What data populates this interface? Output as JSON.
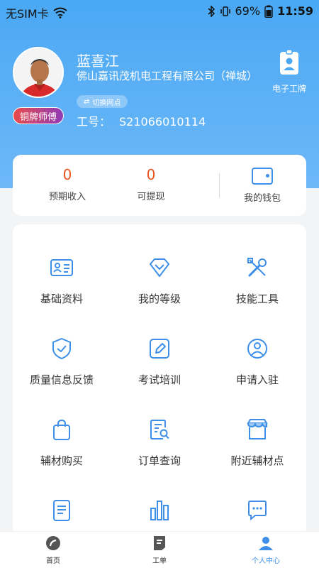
{
  "status_bar": {
    "carrier": "无SIM卡",
    "battery": "69%",
    "time": "11:59"
  },
  "profile": {
    "name": "蓝喜江",
    "company": "佛山嘉讯茂机电工程有限公司（禅城）",
    "switch_label": "切换网点",
    "job_no_label": "工号：",
    "job_no": "S21066010114",
    "rank": "铜牌师傅",
    "badge_label": "电子工牌"
  },
  "wallet": {
    "expected_income_value": "0",
    "expected_income_label": "预期收入",
    "withdrawable_value": "0",
    "withdrawable_label": "可提现",
    "wallet_label": "我的钱包"
  },
  "menu": [
    {
      "label": "基础资料",
      "icon": "id-card-icon"
    },
    {
      "label": "我的等级",
      "icon": "diamond-icon"
    },
    {
      "label": "技能工具",
      "icon": "tools-icon"
    },
    {
      "label": "质量信息反馈",
      "icon": "shield-check-icon"
    },
    {
      "label": "考试培训",
      "icon": "edit-icon"
    },
    {
      "label": "申请入驻",
      "icon": "user-circle-icon"
    },
    {
      "label": "辅材购买",
      "icon": "shopping-bag-icon"
    },
    {
      "label": "订单查询",
      "icon": "document-search-icon"
    },
    {
      "label": "附近辅材点",
      "icon": "store-icon"
    },
    {
      "label": "",
      "icon": "notes-icon"
    },
    {
      "label": "",
      "icon": "bar-chart-icon"
    },
    {
      "label": "",
      "icon": "chat-icon"
    }
  ],
  "tabs": [
    {
      "label": "首页",
      "icon": "home-icon"
    },
    {
      "label": "工单",
      "icon": "order-icon"
    },
    {
      "label": "个人中心",
      "icon": "person-icon"
    }
  ],
  "colors": {
    "primary": "#3d8fe8",
    "accent": "#e8541f",
    "hero": "#4aa8f4"
  }
}
